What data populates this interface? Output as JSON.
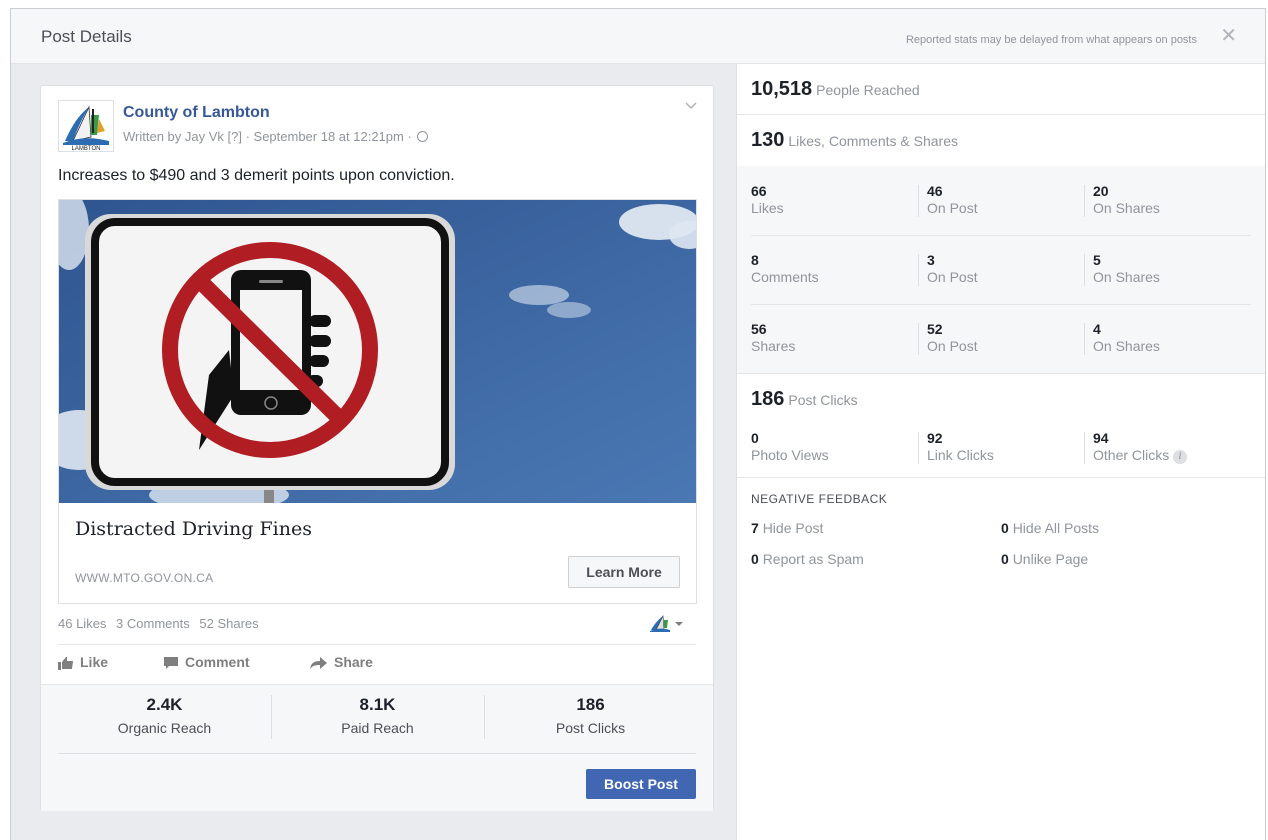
{
  "dialog": {
    "title": "Post Details",
    "note": "Reported stats may be delayed from what appears on posts",
    "close_label": "✕"
  },
  "post": {
    "page_name": "County of Lambton",
    "byline": "Written by Jay Vk [?] · September 18 at 12:21pm ·",
    "text": "Increases to $490 and 3 demerit points upon conviction.",
    "link": {
      "title": "Distracted Driving Fines",
      "domain": "WWW.MTO.GOV.ON.CA",
      "cta": "Learn More"
    },
    "engagement": {
      "likes": "46 Likes",
      "comments": "3 Comments",
      "shares": "52 Shares"
    },
    "actions": {
      "like": "Like",
      "comment": "Comment",
      "share": "Share"
    },
    "stats": [
      {
        "value": "2.4K",
        "label": "Organic Reach"
      },
      {
        "value": "8.1K",
        "label": "Paid Reach"
      },
      {
        "value": "186",
        "label": "Post Clicks"
      }
    ],
    "boost_label": "Boost Post"
  },
  "insights": {
    "reach": {
      "value": "10,518",
      "label": "People Reached"
    },
    "interactions": {
      "value": "130",
      "label": "Likes, Comments & Shares"
    },
    "grid": [
      [
        {
          "n": "66",
          "l": "Likes"
        },
        {
          "n": "46",
          "l": "On Post"
        },
        {
          "n": "20",
          "l": "On Shares"
        }
      ],
      [
        {
          "n": "8",
          "l": "Comments"
        },
        {
          "n": "3",
          "l": "On Post"
        },
        {
          "n": "5",
          "l": "On Shares"
        }
      ],
      [
        {
          "n": "56",
          "l": "Shares"
        },
        {
          "n": "52",
          "l": "On Post"
        },
        {
          "n": "4",
          "l": "On Shares"
        }
      ]
    ],
    "clicks": {
      "value": "186",
      "label": "Post Clicks",
      "items": [
        {
          "n": "0",
          "l": "Photo Views"
        },
        {
          "n": "92",
          "l": "Link Clicks"
        },
        {
          "n": "94",
          "l": "Other Clicks"
        }
      ]
    },
    "negative": {
      "heading": "NEGATIVE FEEDBACK",
      "items": [
        {
          "n": "7",
          "l": "Hide Post"
        },
        {
          "n": "0",
          "l": "Hide All Posts"
        },
        {
          "n": "0",
          "l": "Report as Spam"
        },
        {
          "n": "0",
          "l": "Unlike Page"
        }
      ]
    }
  },
  "colors": {
    "link_blue": "#365899",
    "boost_blue": "#4267b2",
    "sky": "#3e649e",
    "prohibit_red": "#b01e23"
  }
}
